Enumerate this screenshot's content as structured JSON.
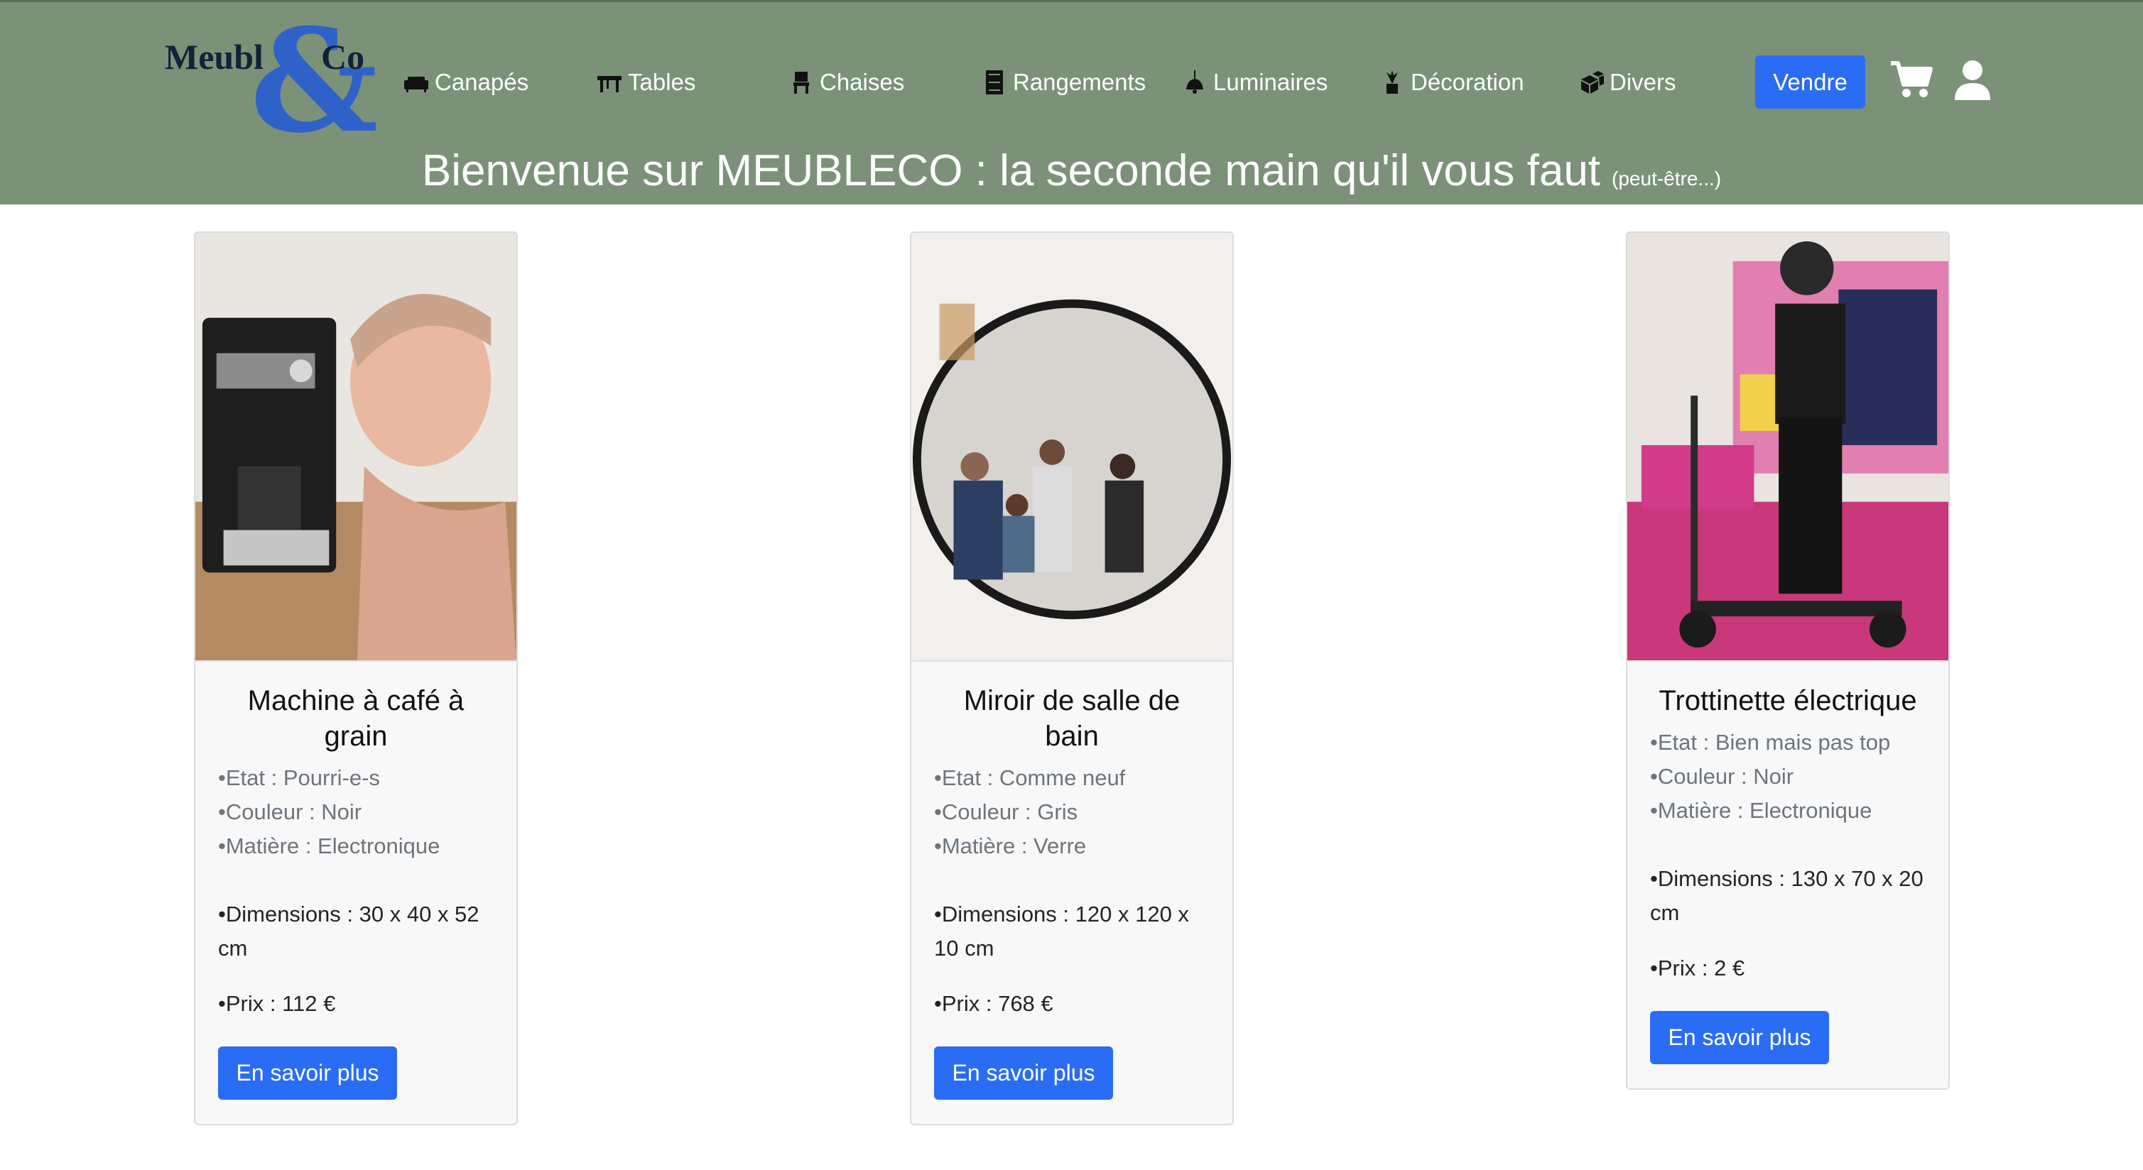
{
  "brand": {
    "logo_left": "Meubl",
    "logo_amp": "&",
    "logo_right": "Co"
  },
  "nav": [
    {
      "label": "Canapés",
      "icon": "sofa-icon"
    },
    {
      "label": "Tables",
      "icon": "table-icon"
    },
    {
      "label": "Chaises",
      "icon": "chair-icon"
    },
    {
      "label": "Rangements",
      "icon": "storage-icon"
    },
    {
      "label": "Luminaires",
      "icon": "lamp-icon"
    },
    {
      "label": "Décoration",
      "icon": "plant-icon"
    },
    {
      "label": "Divers",
      "icon": "boxes-icon"
    }
  ],
  "header": {
    "sell_label": "Vendre",
    "tagline_main": "Bienvenue sur MEUBLECO : la seconde main qu'il vous faut",
    "tagline_small": "(peut-être...)"
  },
  "colors": {
    "header_bg": "#7b9278",
    "accent": "#2a6df4",
    "logo_blue": "#2f62c9"
  },
  "products": [
    {
      "title": "Machine à café à grain",
      "etat": "•Etat : Pourri-e-s",
      "couleur": "•Couleur : Noir",
      "matiere": "•Matière : Electronique",
      "dimensions": "•Dimensions : 30 x 40 x 52 cm",
      "prix": "•Prix : 112 €",
      "button": "En savoir plus"
    },
    {
      "title": "Miroir de salle de bain",
      "etat": "•Etat : Comme neuf",
      "couleur": "•Couleur : Gris",
      "matiere": "•Matière : Verre",
      "dimensions": "•Dimensions : 120 x 120 x 10 cm",
      "prix": "•Prix : 768 €",
      "button": "En savoir plus"
    },
    {
      "title": "Trottinette électrique",
      "etat": "•Etat : Bien mais pas top",
      "couleur": "•Couleur : Noir",
      "matiere": "•Matière : Electronique",
      "dimensions": "•Dimensions : 130 x 70 x 20 cm",
      "prix": "•Prix : 2 €",
      "button": "En savoir plus"
    }
  ]
}
